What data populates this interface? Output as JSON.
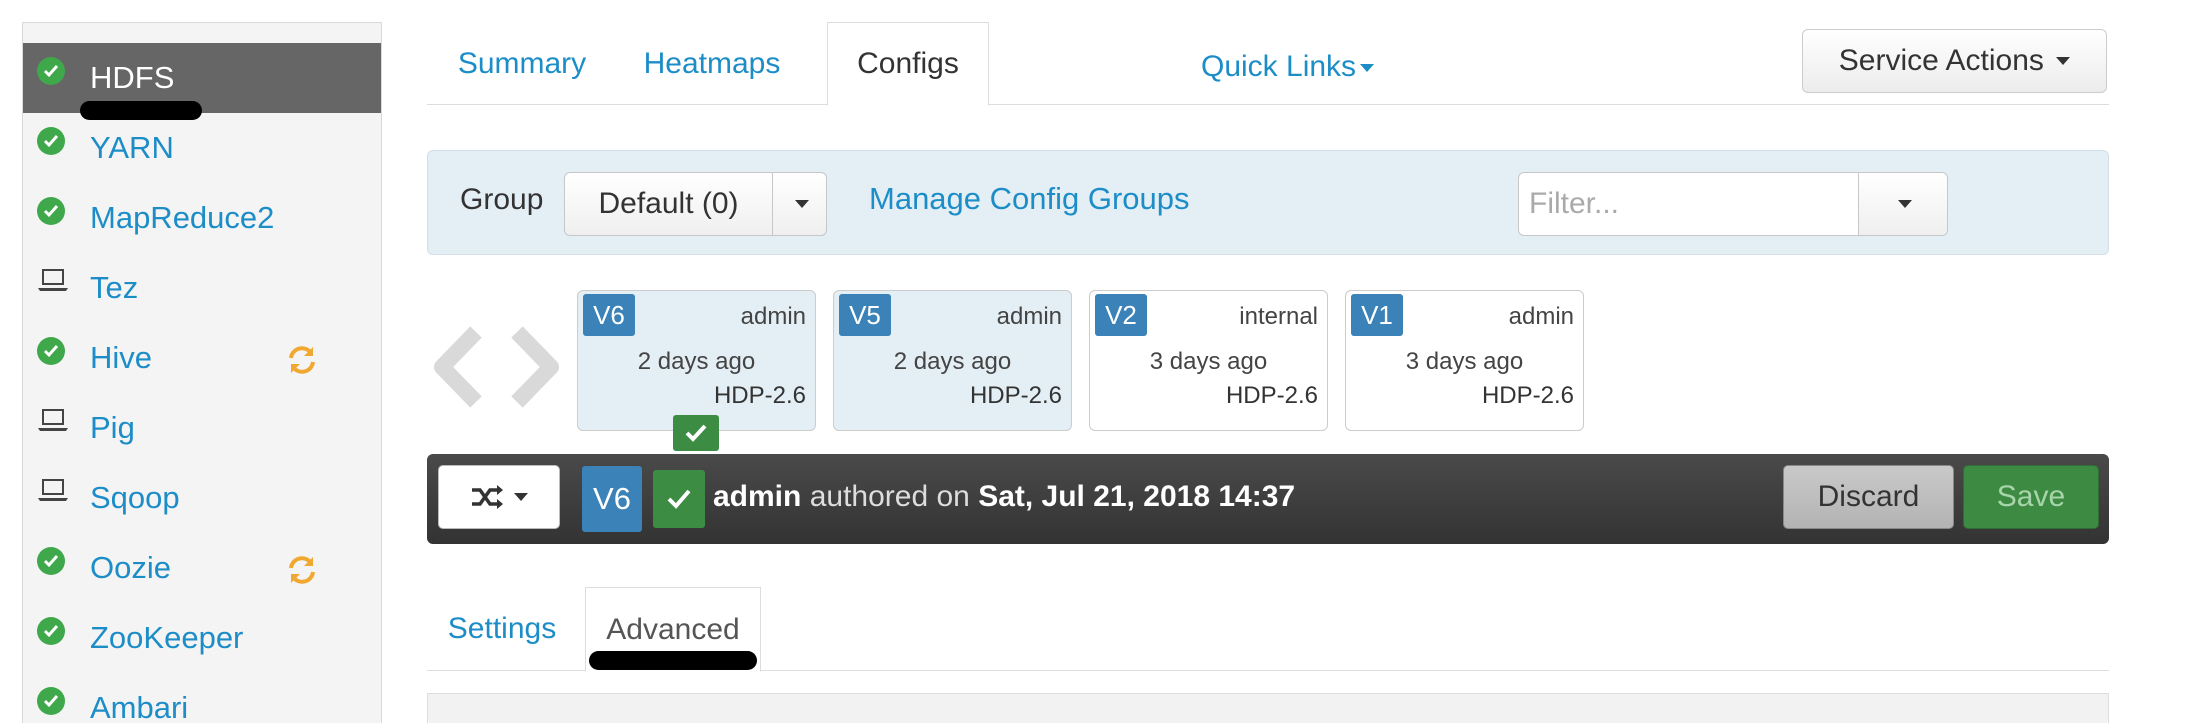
{
  "sidebar": {
    "services": [
      {
        "label": "HDFS",
        "status": "ok",
        "active": true
      },
      {
        "label": "YARN",
        "status": "ok"
      },
      {
        "label": "MapReduce2",
        "status": "ok"
      },
      {
        "label": "Tez",
        "status": "client"
      },
      {
        "label": "Hive",
        "status": "ok",
        "restart": true
      },
      {
        "label": "Pig",
        "status": "client"
      },
      {
        "label": "Sqoop",
        "status": "client"
      },
      {
        "label": "Oozie",
        "status": "ok",
        "restart": true
      },
      {
        "label": "ZooKeeper",
        "status": "ok"
      },
      {
        "label": "Ambari",
        "status": "ok"
      }
    ]
  },
  "tabs": {
    "summary": "Summary",
    "heatmaps": "Heatmaps",
    "configs": "Configs",
    "quick_links": "Quick Links",
    "service_actions": "Service Actions"
  },
  "group_bar": {
    "label": "Group",
    "selected": "Default (0)",
    "manage_link": "Manage Config Groups",
    "filter_placeholder": "Filter..."
  },
  "versions": [
    {
      "badge": "V6",
      "author": "admin",
      "time": "2 days ago",
      "stack": "HDP-2.6",
      "current": true
    },
    {
      "badge": "V5",
      "author": "admin",
      "time": "2 days ago",
      "stack": "HDP-2.6",
      "current": true
    },
    {
      "badge": "V2",
      "author": "internal",
      "time": "3 days ago",
      "stack": "HDP-2.6",
      "current": false
    },
    {
      "badge": "V1",
      "author": "admin",
      "time": "3 days ago",
      "stack": "HDP-2.6",
      "current": false
    }
  ],
  "info_bar": {
    "badge": "V6",
    "author": "admin",
    "authored_on": "authored on",
    "date": "Sat, Jul 21, 2018 14:37",
    "discard": "Discard",
    "save": "Save"
  },
  "subtabs": {
    "settings": "Settings",
    "advanced": "Advanced"
  },
  "colors": {
    "link": "#1d8dc8",
    "ok_green": "#3fa84a",
    "badge_blue": "#3a82b7",
    "restart_orange": "#f0a830"
  }
}
